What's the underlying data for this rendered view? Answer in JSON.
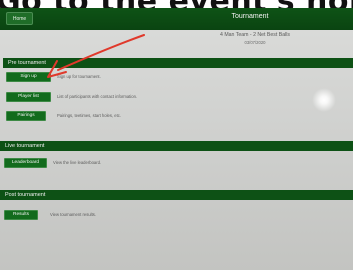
{
  "caption": {
    "text": "Go to the event's homepage to find"
  },
  "header": {
    "home_label": "Home",
    "title": "Tournament"
  },
  "event": {
    "title": "4 Man Team - 2 Net Best Balls",
    "date": "03/07/2020"
  },
  "sections": [
    {
      "heading": "Pre tournament",
      "actions": [
        {
          "button": "Sign up",
          "description": "Sign up for tournament."
        },
        {
          "button": "Player list",
          "description": "List of participants with contact information."
        },
        {
          "button": "Pairings",
          "description": "Pairings, teetimes, start holes, etc."
        }
      ]
    },
    {
      "heading": "Live tournament",
      "actions": [
        {
          "button": "Leaderboard",
          "description": "View the live leaderboard."
        }
      ]
    },
    {
      "heading": "Post tournament",
      "actions": [
        {
          "button": "Results",
          "description": "View tournament results."
        }
      ]
    }
  ],
  "colors": {
    "header_green": "#0d5115",
    "button_green": "#126b1d",
    "annotation_arrow": "#e0392b"
  }
}
